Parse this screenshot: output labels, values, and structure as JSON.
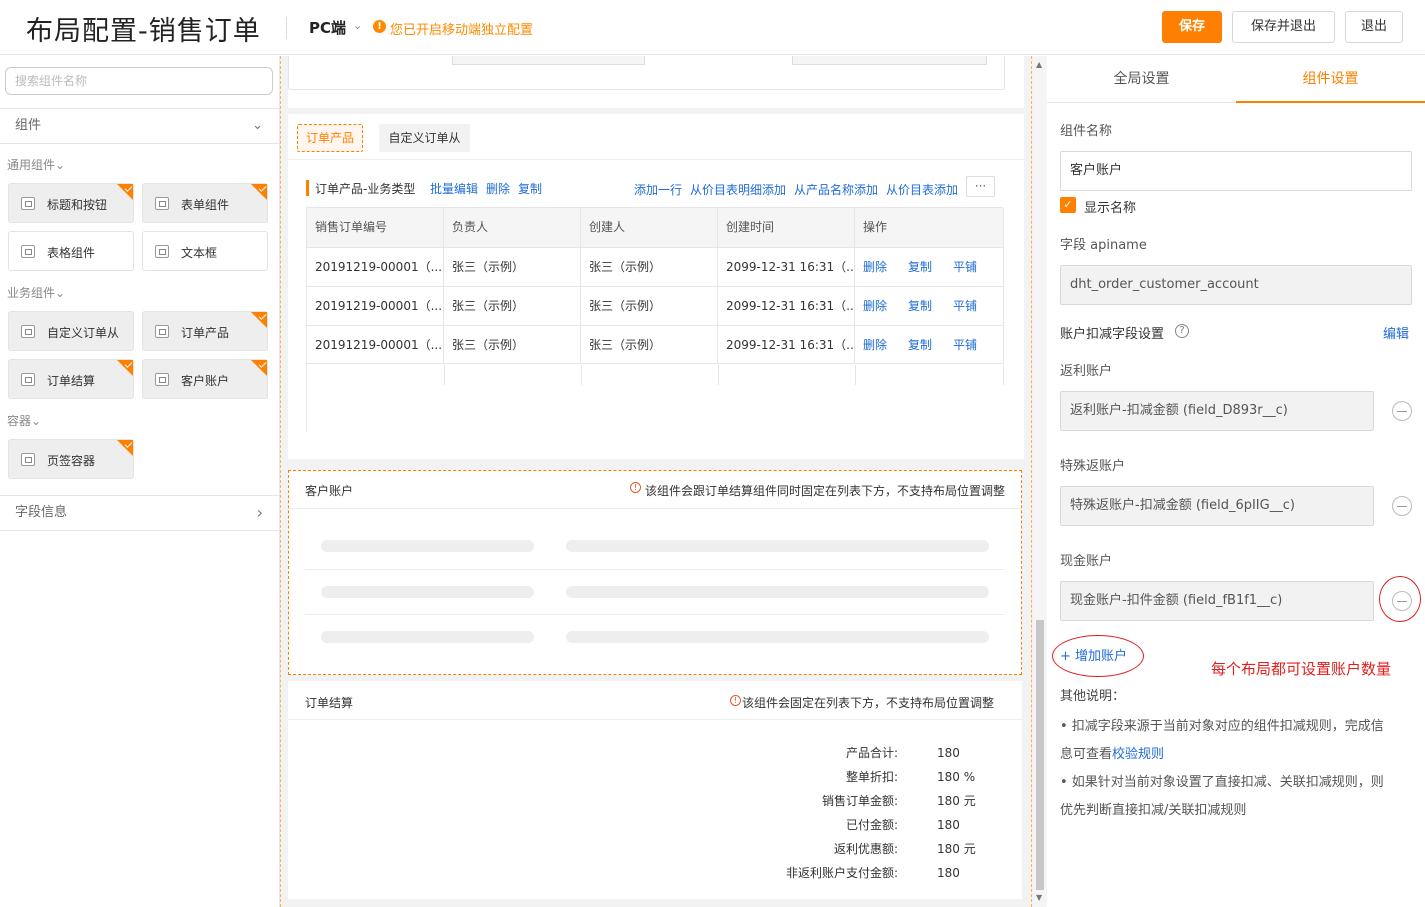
{
  "header": {
    "title": "布局配置-销售订单",
    "platform": "PC端",
    "notice": "您已开启移动端独立配置",
    "save": "保存",
    "save_exit": "保存并退出",
    "exit": "退出"
  },
  "left": {
    "search_placeholder": "搜索组件名称",
    "components_section": "组件",
    "groups": {
      "common": "通用组件",
      "business": "业务组件",
      "container": "容器"
    },
    "items": {
      "title_button": "标题和按钮",
      "form": "表单组件",
      "table": "表格组件",
      "textbox": "文本框",
      "custom_order": "自定义订单从",
      "order_product": "订单产品",
      "order_settle": "订单结算",
      "customer_account": "客户账户",
      "tab_container": "页签容器"
    },
    "field_info": "字段信息"
  },
  "center": {
    "tabs": [
      "订单产品",
      "自定义订单从"
    ],
    "toolbar": {
      "title": "订单产品-业务类型",
      "batch_edit": "批量编辑",
      "delete": "删除",
      "copy": "复制",
      "add_row": "添加一行",
      "add_price_detail": "从价目表明细添加",
      "add_product_name": "从产品名称添加",
      "add_price": "从价目表添加",
      "more": "···"
    },
    "table": {
      "headers": [
        "销售订单编号",
        "负责人",
        "创建人",
        "创建时间",
        "操作"
      ],
      "rows": [
        {
          "no": "20191219-00001（...",
          "owner": "张三（示例）",
          "creator": "张三（示例）",
          "time": "2099-12-31 16:31（..."
        },
        {
          "no": "20191219-00001（...",
          "owner": "张三（示例）",
          "creator": "张三（示例）",
          "time": "2099-12-31 16:31（..."
        },
        {
          "no": "20191219-00001（...",
          "owner": "张三（示例）",
          "creator": "张三（示例）",
          "time": "2099-12-31 16:31（..."
        }
      ],
      "actions": [
        "删除",
        "复制",
        "平铺"
      ]
    },
    "customer_account": {
      "title": "客户账户",
      "note": "该组件会跟订单结算组件同时固定在列表下方，不支持布局位置调整"
    },
    "settlement": {
      "title": "订单结算",
      "note": "该组件会固定在列表下方，不支持布局位置调整",
      "rows": [
        {
          "label": "产品合计:",
          "value": "180"
        },
        {
          "label": "整单折扣:",
          "value": "180 %"
        },
        {
          "label": "销售订单金额:",
          "value": "180 元"
        },
        {
          "label": "已付金额:",
          "value": "180"
        },
        {
          "label": "返利优惠额:",
          "value": "180 元"
        },
        {
          "label": "非返利账户支付金额:",
          "value": "180"
        }
      ]
    }
  },
  "right": {
    "tabs": [
      "全局设置",
      "组件设置"
    ],
    "name_label": "组件名称",
    "name_value": "客户账户",
    "show_name": "显示名称",
    "apiname_label": "字段 apiname",
    "apiname_value": "dht_order_customer_account",
    "deduct_label": "账户扣减字段设置",
    "edit": "编辑",
    "accounts": [
      {
        "label": "返利账户",
        "value": "返利账户-扣减金额 (field_D893r__c)"
      },
      {
        "label": "特殊返账户",
        "value": "特殊返账户-扣减金额 (field_6pIIG__c)"
      },
      {
        "label": "现金账户",
        "value": "现金账户-扣件金额 (field_fB1f1__c)"
      }
    ],
    "add_account": "+ 增加账户",
    "annotation": "每个布局都可设置账户数量",
    "other_title": "其他说明：",
    "note1": "• 扣减字段来源于当前对象对应的组件扣减规则，完成信",
    "note1b": "息可查看",
    "note1_link": "校验规则",
    "note2": "• 如果针对当前对象设置了直接扣减、关联扣减规则，则",
    "note2b": "优先判断直接扣减/关联扣减规则"
  }
}
